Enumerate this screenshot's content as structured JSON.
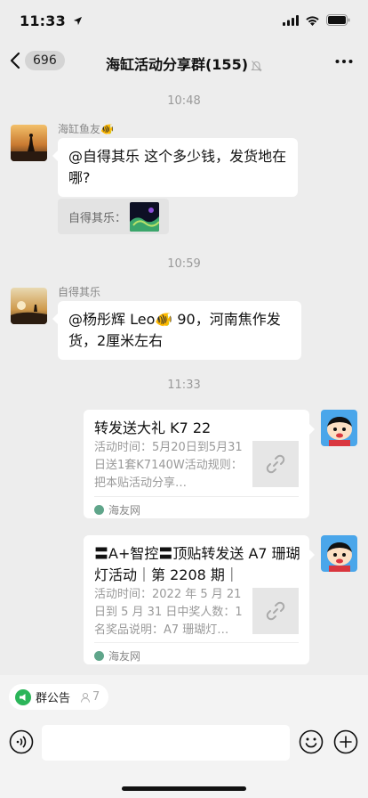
{
  "status_bar": {
    "time": "11:33",
    "icons": [
      "location-arrow-icon",
      "cellular-signal-icon",
      "wifi-icon",
      "battery-icon"
    ]
  },
  "nav": {
    "back_count": "696",
    "title": "海缸活动分享群(155)",
    "icons": [
      "chevron-left-icon",
      "mute-bell-icon",
      "more-icon"
    ]
  },
  "chat": {
    "timestamps": [
      "10:48",
      "10:59",
      "11:33"
    ],
    "messages": [
      {
        "sender": "海缸鱼友🐠",
        "text": "@自得其乐 这个多少钱，发货地在哪?",
        "quote_label": "自得其乐："
      },
      {
        "sender": "自得其乐",
        "text": "@杨彤辉 Leo🐠 90，河南焦作发货，2厘米左右"
      }
    ],
    "link_cards": [
      {
        "title": "转发送大礼 K7 22",
        "description": "活动时间：5月20日到5月31日送1套K7140W活动规则：把本贴活动分享…",
        "source": "海友网"
      },
      {
        "title": "〓A+智控〓顶贴转发送 A7 珊瑚灯活动｜第 2208 期｜",
        "description": "活动时间：2022 年 5 月 21 日到 5 月 31 日中奖人数：1 名奖品说明：A7 珊瑚灯…",
        "source": "海友网"
      }
    ]
  },
  "notice": {
    "label": "群公告",
    "count": "7"
  },
  "input": {
    "placeholder": "",
    "icons": [
      "voice-icon",
      "emoji-icon",
      "plus-icon"
    ]
  },
  "colors": {
    "background": "#ededed",
    "bubble": "#ffffff",
    "quote": "#e3e3e3",
    "bar": "#f3f3f3"
  }
}
